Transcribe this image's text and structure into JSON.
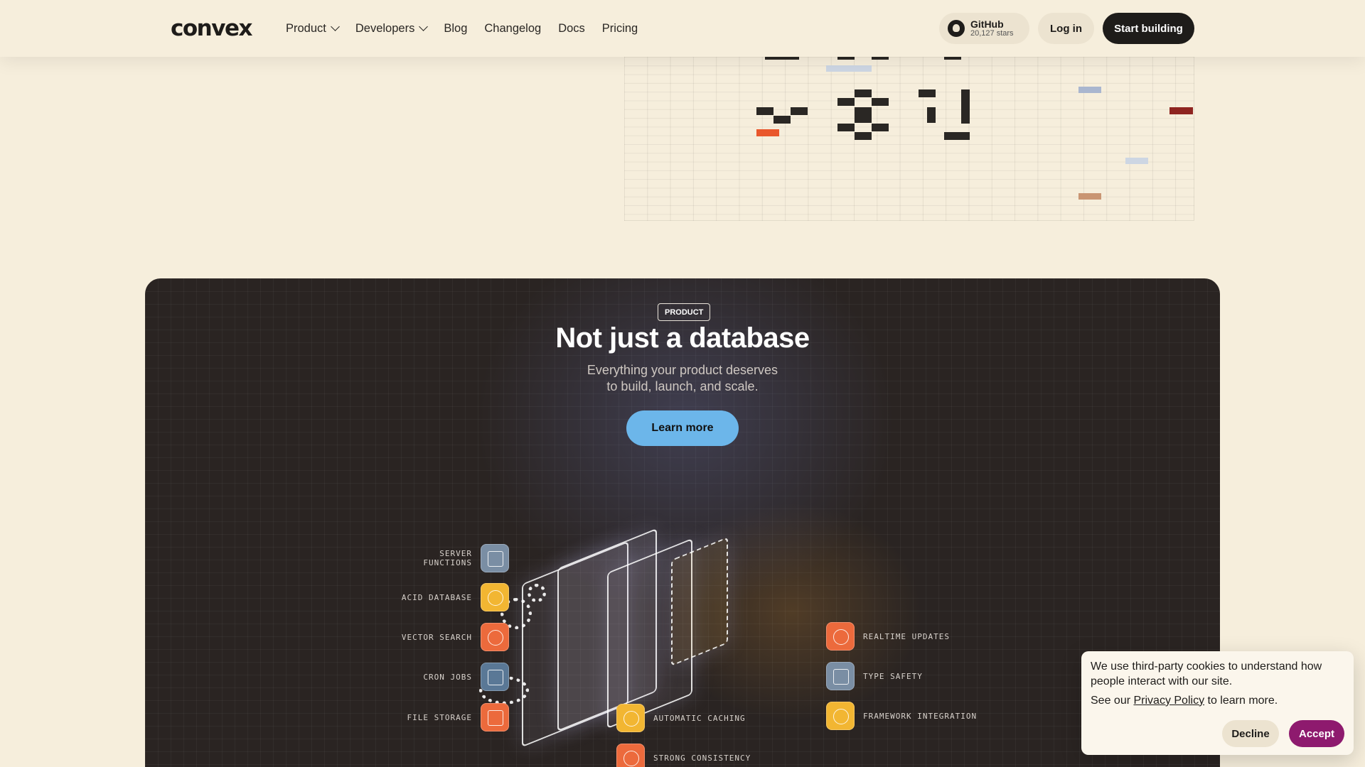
{
  "nav": {
    "logo": "convex",
    "links": [
      {
        "label": "Product",
        "dropdown": true
      },
      {
        "label": "Developers",
        "dropdown": true
      },
      {
        "label": "Blog"
      },
      {
        "label": "Changelog"
      },
      {
        "label": "Docs"
      },
      {
        "label": "Pricing"
      }
    ],
    "github": {
      "title": "GitHub",
      "stars": "20,127 stars"
    },
    "login_label": "Log in",
    "start_label": "Start building"
  },
  "pixel_grid": {
    "colors": {
      "dark": "#2a2724",
      "orange": "#e9572c",
      "blue": "#a9b6cf",
      "lightblue": "#cdd6e3",
      "tan": "#c99573",
      "red": "#8e2420"
    }
  },
  "product_section": {
    "badge": "PRODUCT",
    "title": "Not just a database",
    "subtitle_line1": "Everything your product deserves",
    "subtitle_line2": "to build, launch, and scale.",
    "cta": "Learn more",
    "features_left": [
      {
        "label": "SERVER FUNCTIONS",
        "icon": "lambda-icon",
        "color": "#7a8ea4"
      },
      {
        "label": "ACID DATABASE",
        "icon": "database-icon",
        "color": "#f2b632"
      },
      {
        "label": "VECTOR SEARCH",
        "icon": "vector-icon",
        "color": "#ec6a3c"
      },
      {
        "label": "CRON JOBS",
        "icon": "calendar-icon",
        "color": "#5a7896"
      },
      {
        "label": "FILE STORAGE",
        "icon": "folder-icon",
        "color": "#ec6a3c"
      }
    ],
    "features_right": [
      {
        "label": "REALTIME UPDATES",
        "icon": "refresh-icon",
        "color": "#ec6a3c"
      },
      {
        "label": "TYPE SAFETY",
        "icon": "typescript-icon",
        "color": "#7a8ea4"
      },
      {
        "label": "FRAMEWORK INTEGRATION",
        "icon": "react-icon",
        "color": "#f2b632"
      }
    ],
    "features_bottom": [
      {
        "label": "AUTOMATIC CACHING",
        "icon": "nodes-icon",
        "color": "#f2b632"
      },
      {
        "label": "STRONG CONSISTENCY",
        "icon": "target-icon",
        "color": "#ec6a3c"
      }
    ]
  },
  "cookie": {
    "text": "We use third-party cookies to understand how people interact with our site.",
    "policy_prefix": "See our ",
    "policy_link": "Privacy Policy",
    "policy_suffix": " to learn more.",
    "decline": "Decline",
    "accept": "Accept"
  }
}
